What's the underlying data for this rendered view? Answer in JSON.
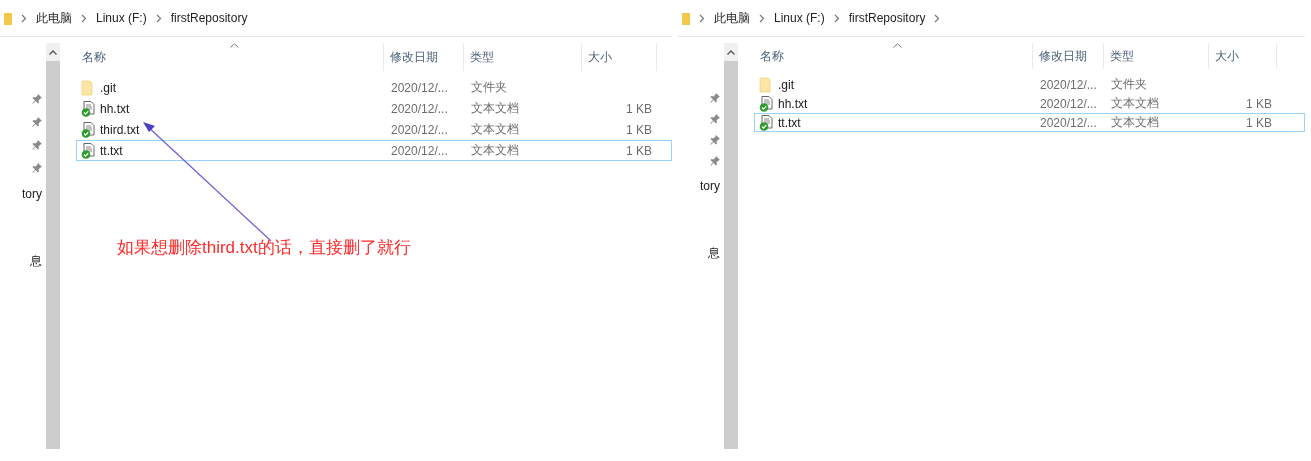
{
  "panes": [
    {
      "breadcrumb": [
        {
          "label": "此电脑"
        },
        {
          "label": "Linux (F:)"
        },
        {
          "label": "firstRepository"
        }
      ],
      "trailing_chevron": false,
      "nav_labels": [
        "tory",
        "息"
      ],
      "columns": [
        {
          "label": "名称",
          "sorted": true
        },
        {
          "label": "修改日期",
          "sorted": false
        },
        {
          "label": "类型",
          "sorted": false
        },
        {
          "label": "大小",
          "sorted": false
        }
      ],
      "rows": [
        {
          "kind": "folder",
          "name": ".git",
          "date": "2020/12/...",
          "type": "文件夹",
          "size": "",
          "selected": false
        },
        {
          "kind": "text",
          "name": "hh.txt",
          "date": "2020/12/...",
          "type": "文本文档",
          "size": "1 KB",
          "selected": false
        },
        {
          "kind": "text",
          "name": "third.txt",
          "date": "2020/12/...",
          "type": "文本文档",
          "size": "1 KB",
          "selected": false
        },
        {
          "kind": "text",
          "name": "tt.txt",
          "date": "2020/12/...",
          "type": "文本文档",
          "size": "1 KB",
          "selected": true
        }
      ],
      "annotation": "如果想删除third.txt的话，直接删了就行"
    },
    {
      "breadcrumb": [
        {
          "label": "此电脑"
        },
        {
          "label": "Linux (F:)"
        },
        {
          "label": "firstRepository"
        }
      ],
      "trailing_chevron": true,
      "nav_labels": [
        "tory",
        "息"
      ],
      "columns": [
        {
          "label": "名称",
          "sorted": true
        },
        {
          "label": "修改日期",
          "sorted": false
        },
        {
          "label": "类型",
          "sorted": false
        },
        {
          "label": "大小",
          "sorted": false
        }
      ],
      "rows": [
        {
          "kind": "folder",
          "name": ".git",
          "date": "2020/12/...",
          "type": "文件夹",
          "size": "",
          "selected": false
        },
        {
          "kind": "text",
          "name": "hh.txt",
          "date": "2020/12/...",
          "type": "文本文档",
          "size": "1 KB",
          "selected": false
        },
        {
          "kind": "text",
          "name": "tt.txt",
          "date": "2020/12/...",
          "type": "文本文档",
          "size": "1 KB",
          "selected": true
        }
      ]
    }
  ]
}
